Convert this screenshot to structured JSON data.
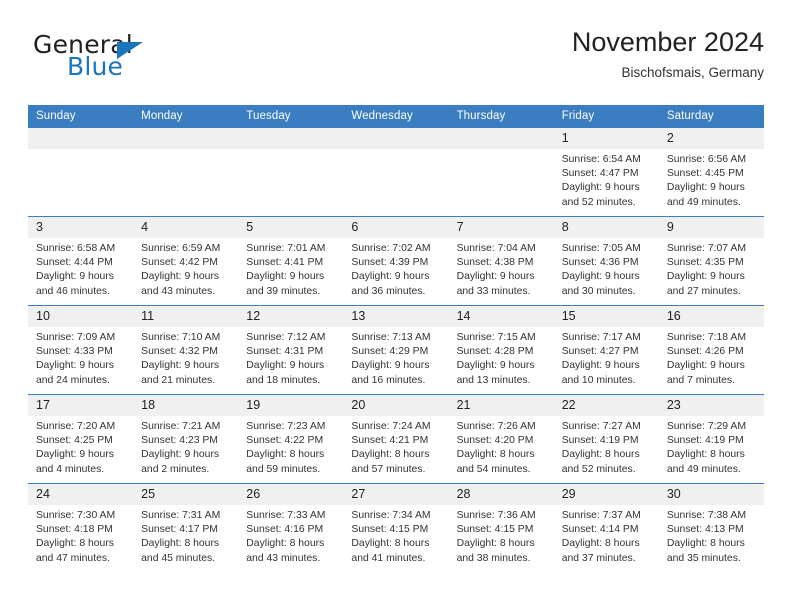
{
  "brand": {
    "name_part1": "General",
    "name_part2": "Blue",
    "accent_color": "#1b75bb"
  },
  "header": {
    "title": "November 2024",
    "location": "Bischofsmais, Germany"
  },
  "calendar": {
    "header_bg": "#3a7dc1",
    "daynum_bg": "#f0f0f0",
    "weekday_headers": [
      "Sunday",
      "Monday",
      "Tuesday",
      "Wednesday",
      "Thursday",
      "Friday",
      "Saturday"
    ],
    "weeks": [
      [
        {
          "day": "",
          "lines": []
        },
        {
          "day": "",
          "lines": []
        },
        {
          "day": "",
          "lines": []
        },
        {
          "day": "",
          "lines": []
        },
        {
          "day": "",
          "lines": []
        },
        {
          "day": "1",
          "lines": [
            "Sunrise: 6:54 AM",
            "Sunset: 4:47 PM",
            "Daylight: 9 hours",
            "and 52 minutes."
          ]
        },
        {
          "day": "2",
          "lines": [
            "Sunrise: 6:56 AM",
            "Sunset: 4:45 PM",
            "Daylight: 9 hours",
            "and 49 minutes."
          ]
        }
      ],
      [
        {
          "day": "3",
          "lines": [
            "Sunrise: 6:58 AM",
            "Sunset: 4:44 PM",
            "Daylight: 9 hours",
            "and 46 minutes."
          ]
        },
        {
          "day": "4",
          "lines": [
            "Sunrise: 6:59 AM",
            "Sunset: 4:42 PM",
            "Daylight: 9 hours",
            "and 43 minutes."
          ]
        },
        {
          "day": "5",
          "lines": [
            "Sunrise: 7:01 AM",
            "Sunset: 4:41 PM",
            "Daylight: 9 hours",
            "and 39 minutes."
          ]
        },
        {
          "day": "6",
          "lines": [
            "Sunrise: 7:02 AM",
            "Sunset: 4:39 PM",
            "Daylight: 9 hours",
            "and 36 minutes."
          ]
        },
        {
          "day": "7",
          "lines": [
            "Sunrise: 7:04 AM",
            "Sunset: 4:38 PM",
            "Daylight: 9 hours",
            "and 33 minutes."
          ]
        },
        {
          "day": "8",
          "lines": [
            "Sunrise: 7:05 AM",
            "Sunset: 4:36 PM",
            "Daylight: 9 hours",
            "and 30 minutes."
          ]
        },
        {
          "day": "9",
          "lines": [
            "Sunrise: 7:07 AM",
            "Sunset: 4:35 PM",
            "Daylight: 9 hours",
            "and 27 minutes."
          ]
        }
      ],
      [
        {
          "day": "10",
          "lines": [
            "Sunrise: 7:09 AM",
            "Sunset: 4:33 PM",
            "Daylight: 9 hours",
            "and 24 minutes."
          ]
        },
        {
          "day": "11",
          "lines": [
            "Sunrise: 7:10 AM",
            "Sunset: 4:32 PM",
            "Daylight: 9 hours",
            "and 21 minutes."
          ]
        },
        {
          "day": "12",
          "lines": [
            "Sunrise: 7:12 AM",
            "Sunset: 4:31 PM",
            "Daylight: 9 hours",
            "and 18 minutes."
          ]
        },
        {
          "day": "13",
          "lines": [
            "Sunrise: 7:13 AM",
            "Sunset: 4:29 PM",
            "Daylight: 9 hours",
            "and 16 minutes."
          ]
        },
        {
          "day": "14",
          "lines": [
            "Sunrise: 7:15 AM",
            "Sunset: 4:28 PM",
            "Daylight: 9 hours",
            "and 13 minutes."
          ]
        },
        {
          "day": "15",
          "lines": [
            "Sunrise: 7:17 AM",
            "Sunset: 4:27 PM",
            "Daylight: 9 hours",
            "and 10 minutes."
          ]
        },
        {
          "day": "16",
          "lines": [
            "Sunrise: 7:18 AM",
            "Sunset: 4:26 PM",
            "Daylight: 9 hours",
            "and 7 minutes."
          ]
        }
      ],
      [
        {
          "day": "17",
          "lines": [
            "Sunrise: 7:20 AM",
            "Sunset: 4:25 PM",
            "Daylight: 9 hours",
            "and 4 minutes."
          ]
        },
        {
          "day": "18",
          "lines": [
            "Sunrise: 7:21 AM",
            "Sunset: 4:23 PM",
            "Daylight: 9 hours",
            "and 2 minutes."
          ]
        },
        {
          "day": "19",
          "lines": [
            "Sunrise: 7:23 AM",
            "Sunset: 4:22 PM",
            "Daylight: 8 hours",
            "and 59 minutes."
          ]
        },
        {
          "day": "20",
          "lines": [
            "Sunrise: 7:24 AM",
            "Sunset: 4:21 PM",
            "Daylight: 8 hours",
            "and 57 minutes."
          ]
        },
        {
          "day": "21",
          "lines": [
            "Sunrise: 7:26 AM",
            "Sunset: 4:20 PM",
            "Daylight: 8 hours",
            "and 54 minutes."
          ]
        },
        {
          "day": "22",
          "lines": [
            "Sunrise: 7:27 AM",
            "Sunset: 4:19 PM",
            "Daylight: 8 hours",
            "and 52 minutes."
          ]
        },
        {
          "day": "23",
          "lines": [
            "Sunrise: 7:29 AM",
            "Sunset: 4:19 PM",
            "Daylight: 8 hours",
            "and 49 minutes."
          ]
        }
      ],
      [
        {
          "day": "24",
          "lines": [
            "Sunrise: 7:30 AM",
            "Sunset: 4:18 PM",
            "Daylight: 8 hours",
            "and 47 minutes."
          ]
        },
        {
          "day": "25",
          "lines": [
            "Sunrise: 7:31 AM",
            "Sunset: 4:17 PM",
            "Daylight: 8 hours",
            "and 45 minutes."
          ]
        },
        {
          "day": "26",
          "lines": [
            "Sunrise: 7:33 AM",
            "Sunset: 4:16 PM",
            "Daylight: 8 hours",
            "and 43 minutes."
          ]
        },
        {
          "day": "27",
          "lines": [
            "Sunrise: 7:34 AM",
            "Sunset: 4:15 PM",
            "Daylight: 8 hours",
            "and 41 minutes."
          ]
        },
        {
          "day": "28",
          "lines": [
            "Sunrise: 7:36 AM",
            "Sunset: 4:15 PM",
            "Daylight: 8 hours",
            "and 38 minutes."
          ]
        },
        {
          "day": "29",
          "lines": [
            "Sunrise: 7:37 AM",
            "Sunset: 4:14 PM",
            "Daylight: 8 hours",
            "and 37 minutes."
          ]
        },
        {
          "day": "30",
          "lines": [
            "Sunrise: 7:38 AM",
            "Sunset: 4:13 PM",
            "Daylight: 8 hours",
            "and 35 minutes."
          ]
        }
      ]
    ]
  }
}
